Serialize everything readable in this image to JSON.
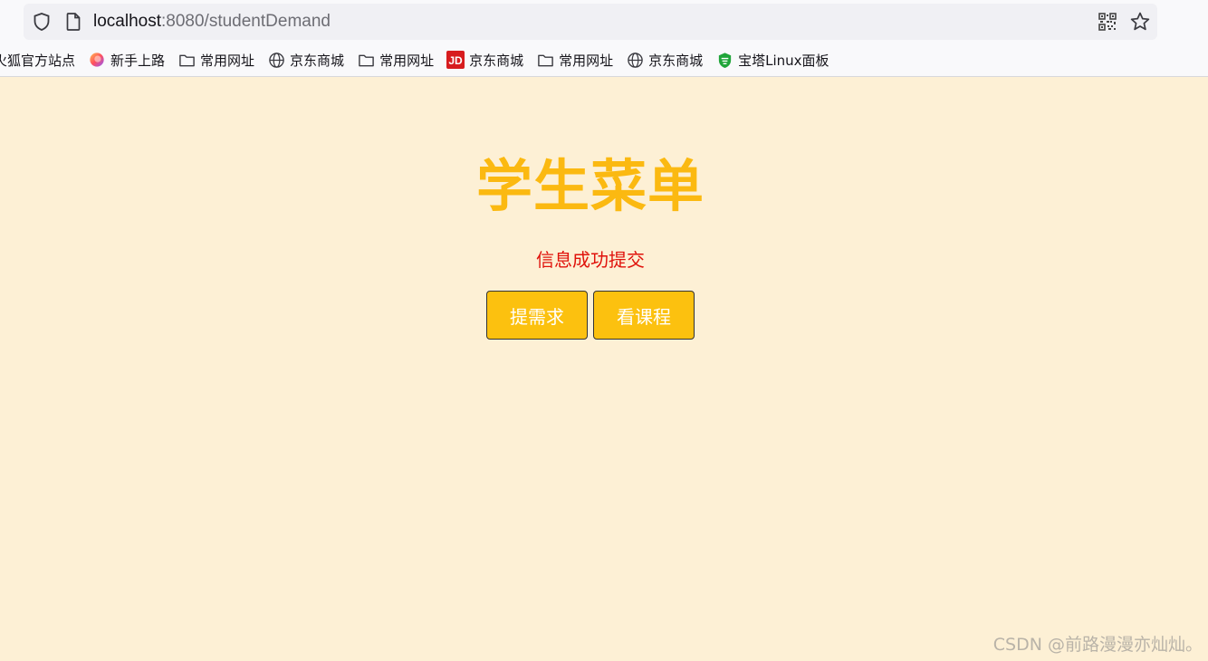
{
  "browser": {
    "url_host": "localhost",
    "url_path": ":8080/studentDemand",
    "icons": [
      "shield-icon",
      "page-icon",
      "qr-code-icon",
      "star-icon"
    ]
  },
  "bookmarks": [
    {
      "label": "火狐官方站点",
      "icon": "firefox-icon"
    },
    {
      "label": "新手上路",
      "icon": "firefox-icon"
    },
    {
      "label": "常用网址",
      "icon": "folder-icon"
    },
    {
      "label": "京东商城",
      "icon": "globe-icon"
    },
    {
      "label": "常用网址",
      "icon": "folder-icon"
    },
    {
      "label": "京东商城",
      "icon": "jd-icon"
    },
    {
      "label": "常用网址",
      "icon": "folder-icon"
    },
    {
      "label": "京东商城",
      "icon": "globe-icon"
    },
    {
      "label": "宝塔Linux面板",
      "icon": "baota-icon"
    }
  ],
  "page": {
    "title": "学生菜单",
    "status_message": "信息成功提交",
    "buttons": {
      "submit_demand": "提需求",
      "view_courses": "看课程"
    }
  },
  "watermark": "CSDN @前路漫漫亦灿灿。",
  "colors": {
    "background": "#fdf0d5",
    "title": "#fbb911",
    "status": "#e0120b",
    "button": "#fcc10f"
  }
}
